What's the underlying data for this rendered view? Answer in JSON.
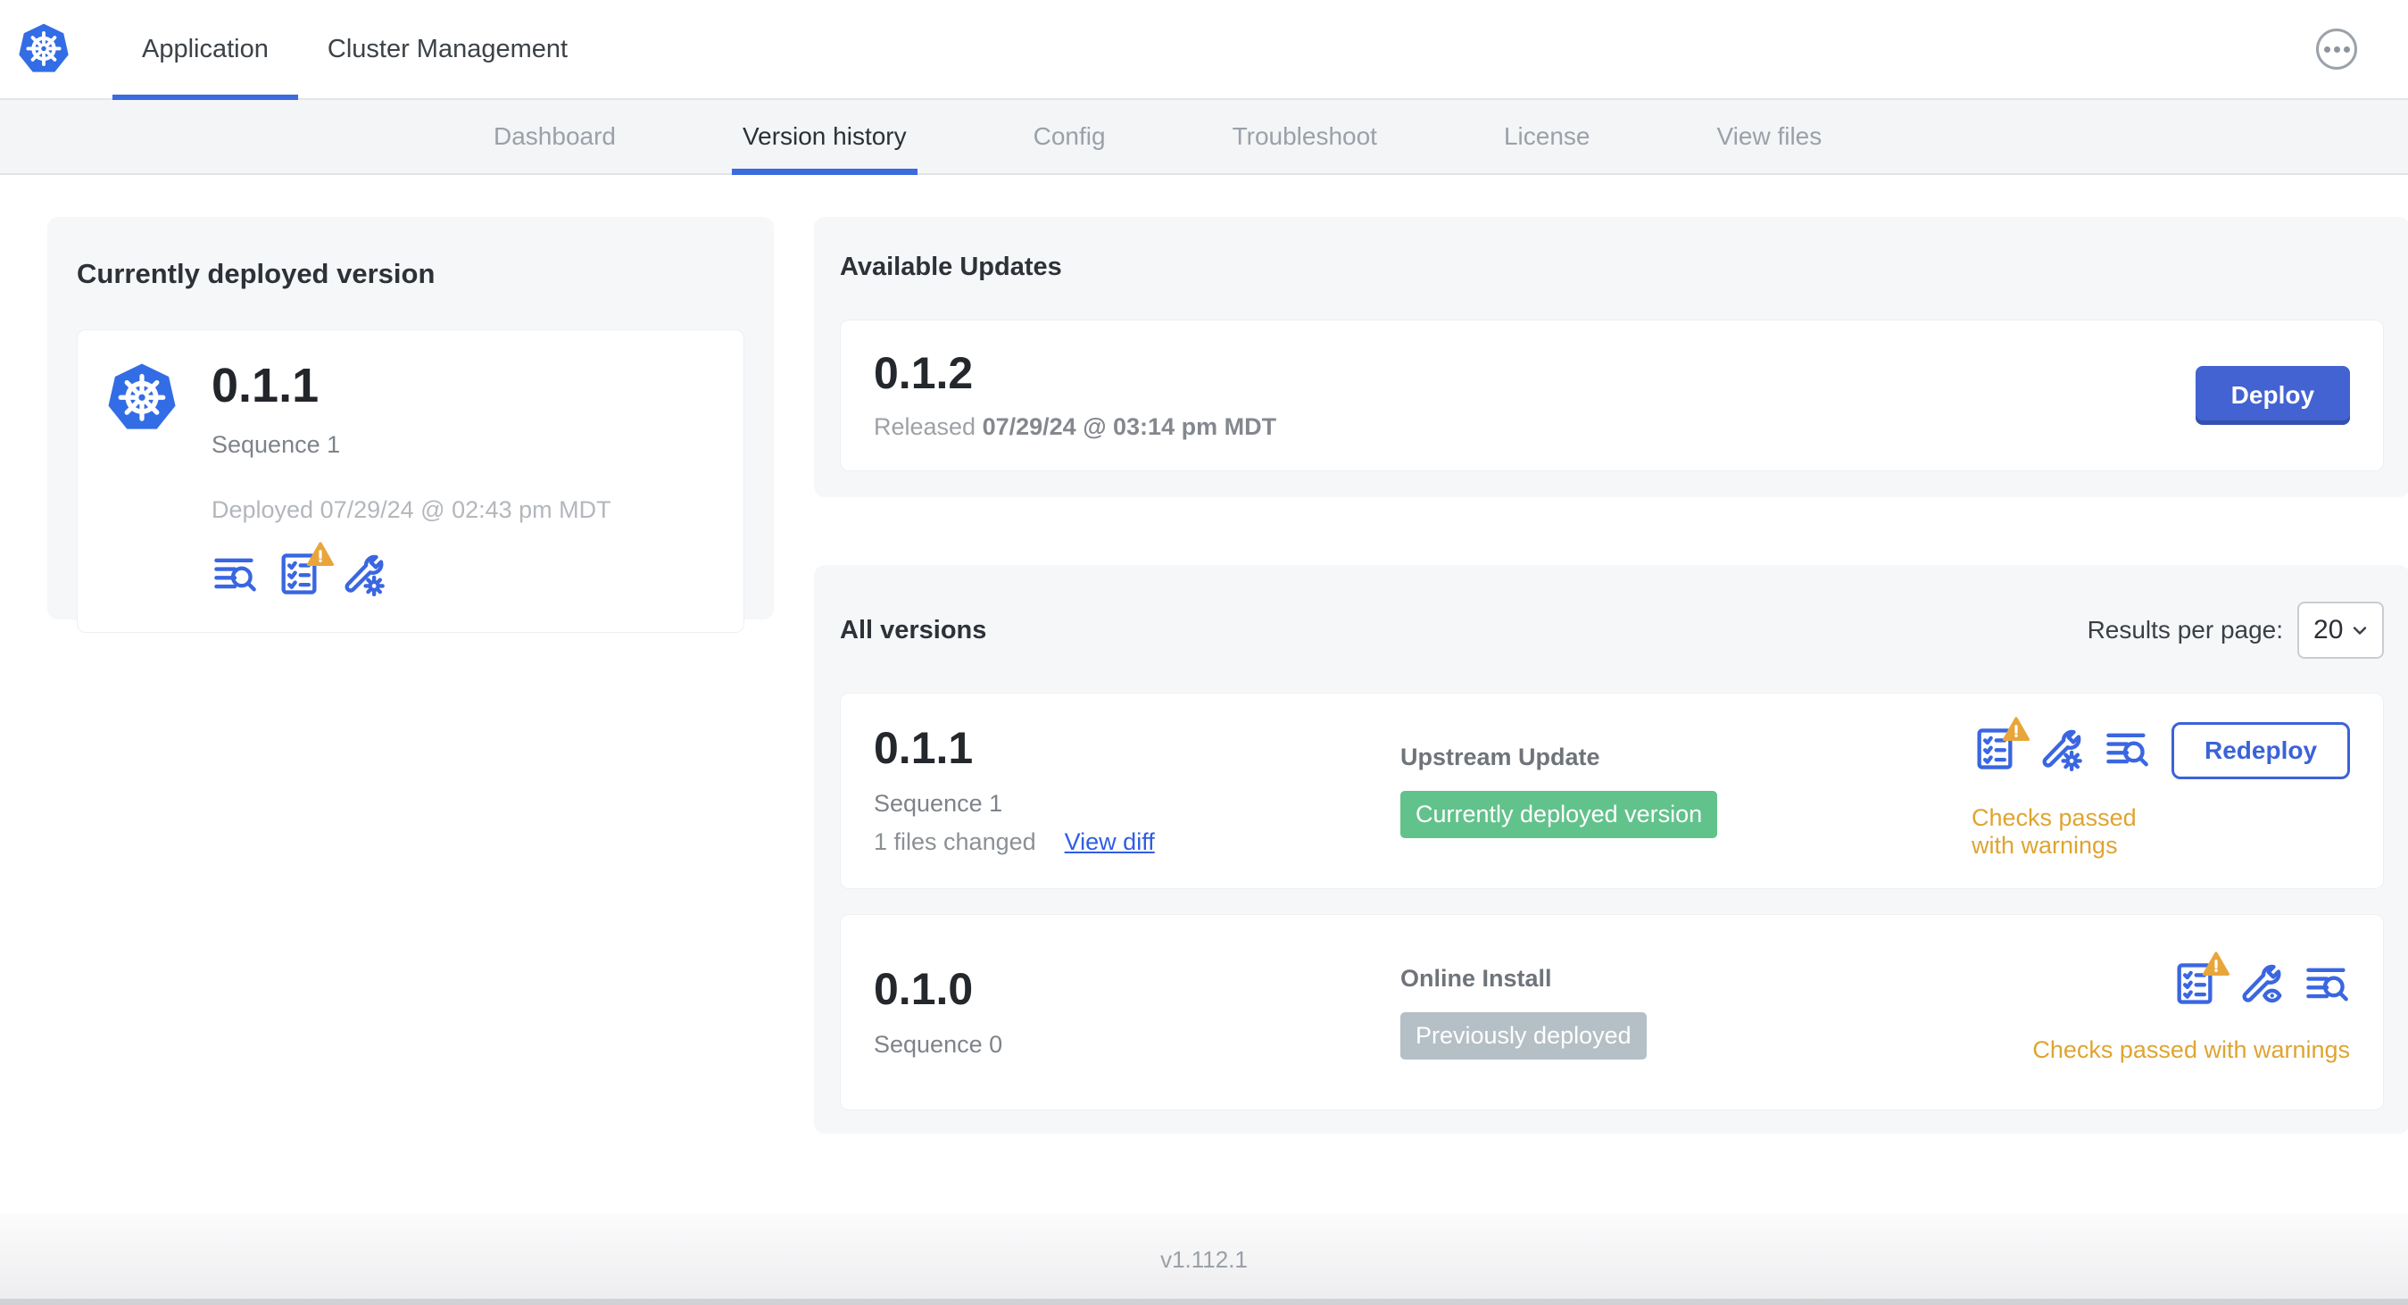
{
  "top_nav": {
    "logo_icon": "kubernetes-logo",
    "tabs": [
      {
        "label": "Application",
        "active": true
      },
      {
        "label": "Cluster Management",
        "active": false
      }
    ],
    "menu_icon": "ellipsis-menu-icon"
  },
  "sub_nav": {
    "tabs": [
      {
        "label": "Dashboard",
        "active": false
      },
      {
        "label": "Version history",
        "active": true
      },
      {
        "label": "Config",
        "active": false
      },
      {
        "label": "Troubleshoot",
        "active": false
      },
      {
        "label": "License",
        "active": false
      },
      {
        "label": "View files",
        "active": false
      }
    ]
  },
  "current_version_card": {
    "title": "Currently deployed version",
    "version": "0.1.1",
    "sequence": "Sequence 1",
    "deployed_at": "Deployed 07/29/24 @ 02:43 pm MDT",
    "icons": [
      "logs-icon",
      "preflight-checks-warning-icon",
      "config-edit-icon"
    ]
  },
  "available_updates": {
    "title": "Available Updates",
    "update": {
      "version": "0.1.2",
      "released_label": "Released",
      "released_at": "07/29/24 @ 03:14 pm MDT",
      "deploy_label": "Deploy"
    }
  },
  "all_versions": {
    "title": "All versions",
    "results_per_page_label": "Results per page:",
    "results_per_page_value": "20",
    "rows": [
      {
        "version": "0.1.1",
        "sequence": "Sequence 1",
        "files_changed": "1 files changed",
        "view_diff_label": "View diff",
        "source": "Upstream Update",
        "badge": {
          "label": "Currently deployed version",
          "type": "success"
        },
        "icons": [
          "preflight-checks-warning-icon",
          "config-edit-icon",
          "logs-icon"
        ],
        "action_label": "Redeploy",
        "status": "Checks passed with warnings"
      },
      {
        "version": "0.1.0",
        "sequence": "Sequence 0",
        "source": "Online Install",
        "badge": {
          "label": "Previously deployed",
          "type": "muted"
        },
        "icons": [
          "preflight-checks-warning-icon",
          "config-view-icon",
          "logs-icon"
        ],
        "status": "Checks passed with warnings"
      }
    ]
  },
  "footer": {
    "version": "v1.112.1"
  },
  "colors": {
    "accent_blue": "#3b6bdd",
    "button_blue": "#4363d2",
    "link_blue": "#2f5de4",
    "badge_green": "#62c28b",
    "badge_gray": "#b5bfc6",
    "warning_amber": "#dfa430",
    "k8s_logo_blue": "#326de6"
  }
}
